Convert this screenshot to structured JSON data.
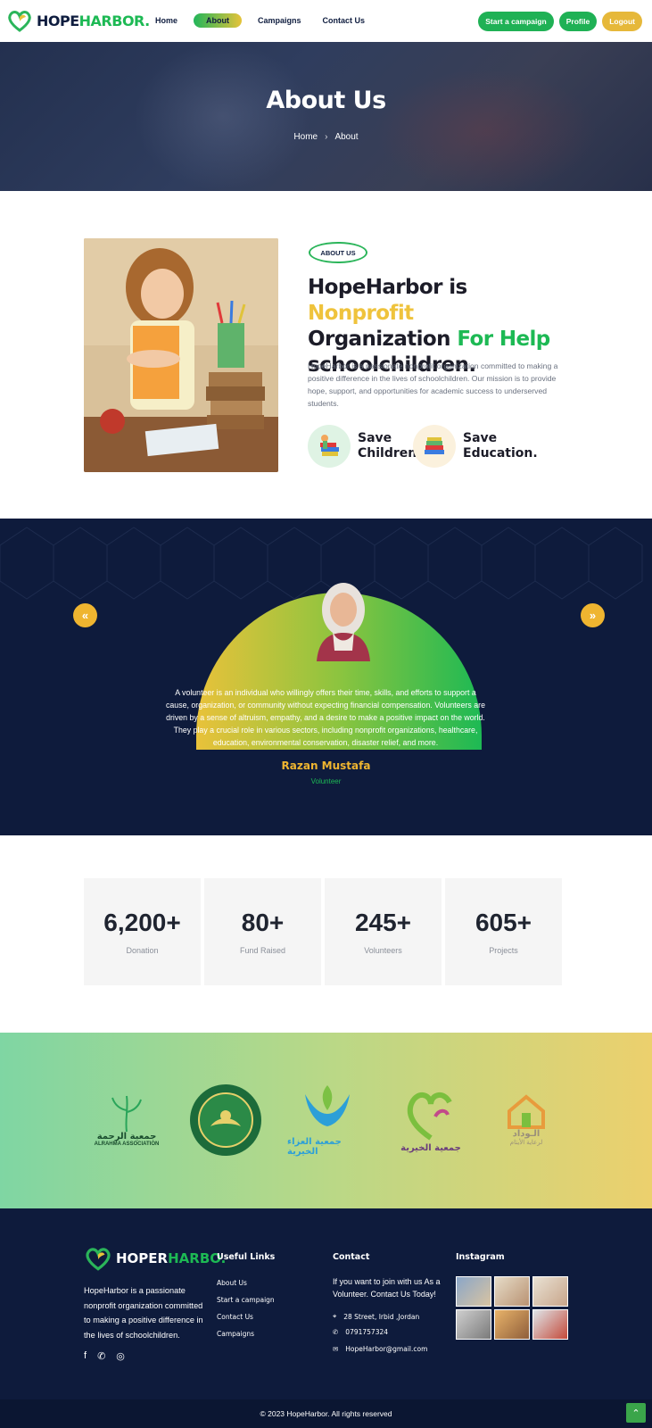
{
  "brand": {
    "part1": "HOPE",
    "part2": "HARBOR."
  },
  "nav": {
    "links": [
      "Home",
      "About",
      "Campaigns",
      "Contact Us"
    ],
    "buttons": {
      "start": "Start a campaign",
      "profile": "Profile",
      "logout": "Logout"
    }
  },
  "hero": {
    "title": "About Us",
    "crumb_home": "Home",
    "crumb_sep": "›",
    "crumb_current": "About"
  },
  "about": {
    "tag": "ABOUT US",
    "heading_1": "HopeHarbor is ",
    "heading_2": "Nonprofit",
    "heading_3": "Organization ",
    "heading_4": "For Help",
    "heading_5": "schoolchildren.",
    "paragraph": "HopeHarbor is a passionate nonprofit organization committed to making a positive difference in the lives of schoolchildren. Our mission is to provide hope, support, and opportunities for academic success to underserved students.",
    "features": [
      {
        "label_1": "Save",
        "label_2": "Children."
      },
      {
        "label_1": "Save",
        "label_2": "Education."
      }
    ]
  },
  "testimonial": {
    "prev": "«",
    "next": "»",
    "quote": "A volunteer is an individual who willingly offers their time, skills, and efforts to support a cause, organization, or community without expecting financial compensation. Volunteers are driven by a sense of altruism, empathy, and a desire to make a positive impact on the world. They play a crucial role in various sectors, including nonprofit organizations, healthcare, education, environmental conservation, disaster relief, and more.",
    "name": "Razan Mustafa",
    "role": "Volunteer"
  },
  "stats": [
    {
      "value": "6,200+",
      "label": "Donation"
    },
    {
      "value": "80+",
      "label": "Fund Raised"
    },
    {
      "value": "245+",
      "label": "Volunteers"
    },
    {
      "value": "605+",
      "label": "Projects"
    }
  ],
  "partners": [
    {
      "ar": "جمعية الرحمة",
      "en": "ALRAHMA ASSOCIATION"
    },
    {
      "ar": "",
      "en": ""
    },
    {
      "ar": "جمعية العزاء الخيرية",
      "en": ""
    },
    {
      "ar": "جمعية الخيرية",
      "en": ""
    },
    {
      "ar": "الـوداد",
      "en": "لرعاية الأيتام"
    }
  ],
  "footer": {
    "logo_1": "HOPER",
    "logo_2": "HARBO.",
    "about": "HopeHarbor is a passionate nonprofit organization committed to making a positive difference in the lives of schoolchildren.",
    "social": [
      "facebook-icon",
      "whatsapp-icon",
      "instagram-icon"
    ],
    "useful_title": "Useful Links",
    "useful_links": [
      "About Us",
      "Start a campaign",
      "Contact Us",
      "Campaigns"
    ],
    "contact_title": "Contact",
    "contact_text": "If you want to join with us As a Volunteer. Contact Us Today!",
    "address": "28 Street, Irbid ,Jordan",
    "phone": "0791757324",
    "email": "HopeHarbor@gmail.com",
    "instagram_title": "Instagram"
  },
  "copyright": "© 2023 HopeHarbor. All rights reserved",
  "colors": {
    "navy": "#0e1b3c",
    "green": "#1db954",
    "yellow": "#efc33c"
  }
}
